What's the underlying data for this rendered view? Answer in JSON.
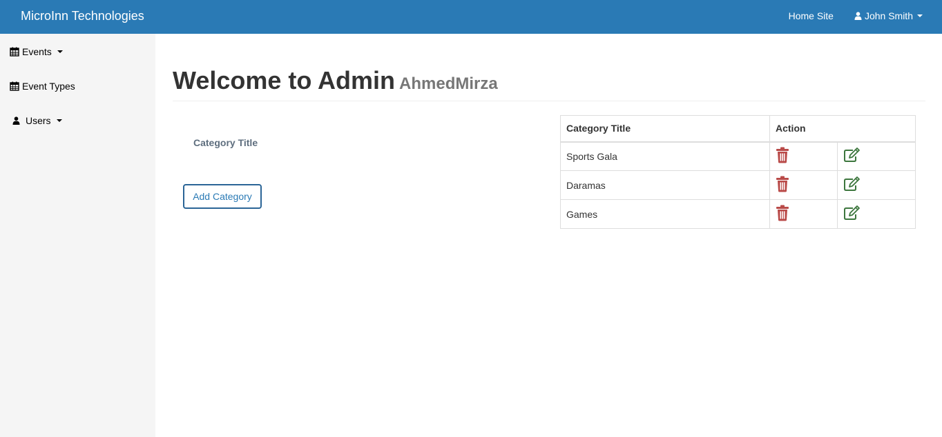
{
  "navbar": {
    "brand": "MicroInn Technologies",
    "home_site": "Home Site",
    "user_name": "John Smith"
  },
  "sidebar": {
    "items": [
      {
        "label": "Events",
        "icon": "calendar-icon",
        "dropdown": true
      },
      {
        "label": "Event Types",
        "icon": "calendar-icon",
        "dropdown": false
      },
      {
        "label": "Users",
        "icon": "user-icon",
        "dropdown": true
      }
    ]
  },
  "page": {
    "title": "Welcome to Admin",
    "subtitle": "AhmedMirza"
  },
  "form": {
    "label": "Category Title",
    "add_button": "Add Category"
  },
  "table": {
    "headers": [
      "Category Title",
      "Action"
    ],
    "rows": [
      {
        "title": "Sports Gala"
      },
      {
        "title": "Daramas"
      },
      {
        "title": "Games"
      }
    ]
  },
  "colors": {
    "navbar": "#2a7ab5",
    "delete_icon": "#b94a48",
    "edit_icon": "#3c763d"
  }
}
